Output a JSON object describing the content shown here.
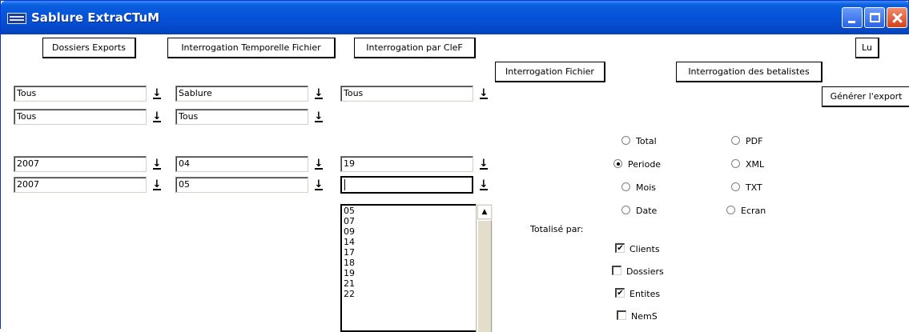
{
  "window": {
    "title": "Sablure ExtraCTuM",
    "minimize_glyph": "",
    "close_glyph": ""
  },
  "buttons": {
    "dossiers_exports": "Dossiers Exports",
    "interrogation_temporelle": "Interrogation Temporelle Fichier",
    "interrogation_clef": "Interrogation par CleF",
    "lu": "Lu",
    "interrogation_fichier": "Interrogation Fichier",
    "interrogation_betalistes": "Interrogation des betalistes",
    "generer_export": "Générer l'export"
  },
  "selectors": {
    "row1": [
      "Tous",
      "Sablure",
      "Tous"
    ],
    "row2": [
      "Tous",
      "Tous"
    ],
    "date_from": [
      "2007",
      "04",
      "19"
    ],
    "date_to": [
      "2007",
      "05",
      ""
    ]
  },
  "day_list": [
    "05",
    "07",
    "09",
    "14",
    "17",
    "18",
    "19",
    "21",
    "22"
  ],
  "period_options": [
    {
      "label": "Total",
      "selected": false
    },
    {
      "label": "Periode",
      "selected": true
    },
    {
      "label": "Mois",
      "selected": false
    },
    {
      "label": "Date",
      "selected": false
    }
  ],
  "format_options": [
    {
      "label": "PDF",
      "selected": false
    },
    {
      "label": "XML",
      "selected": false
    },
    {
      "label": "TXT",
      "selected": false
    },
    {
      "label": "Ecran",
      "selected": false
    }
  ],
  "totalise_label": "Totalisé par:",
  "totalise_options": [
    {
      "label": "Clients",
      "checked": true
    },
    {
      "label": "Dossiers",
      "checked": false
    },
    {
      "label": "Entites",
      "checked": true
    },
    {
      "label": "NemS",
      "checked": false
    }
  ],
  "check_mark": "✔"
}
